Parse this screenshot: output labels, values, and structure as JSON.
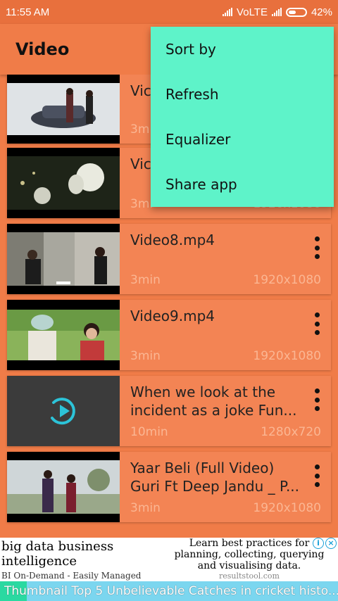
{
  "status_bar": {
    "time": "11:55 AM",
    "network": "VoLTE",
    "battery": "42%",
    "icons": [
      "signal-icon",
      "signal-icon",
      "battery-icon"
    ]
  },
  "app_bar": {
    "title": "Video"
  },
  "videos": [
    {
      "title": "Vic",
      "duration": "3m",
      "resolution": "",
      "thumb": "car-scene"
    },
    {
      "title": "Vic",
      "duration": "3mi",
      "resolution": "1920x1080",
      "thumb": "lanterns"
    },
    {
      "title": "Video8.mp4",
      "duration": "3min",
      "resolution": "1920x1080",
      "thumb": "couple-street"
    },
    {
      "title": "Video9.mp4",
      "duration": "3min",
      "resolution": "1920x1080",
      "thumb": "couple-field"
    },
    {
      "title": "When we look at the incident as a joke Fun...",
      "duration": "10min",
      "resolution": "1280x720",
      "thumb": "play-placeholder"
    },
    {
      "title": "Yaar Beli (Full Video) Guri Ft Deep Jandu _ P...",
      "duration": "3min",
      "resolution": "1920x1080",
      "thumb": "park-couple"
    }
  ],
  "overflow_menu": {
    "items": [
      "Sort by",
      "Refresh",
      "Equalizer",
      "Share app"
    ]
  },
  "ad_banner": {
    "left_heading": "big data business intelligence",
    "left_sub": "BI On-Demand - Easily Managed",
    "right_text": "Learn best practices for planning, collecting, querying and visualising data.",
    "right_url": "resultstool.com",
    "adchoice_icons": [
      "info-icon",
      "close-icon"
    ]
  },
  "ticker": {
    "text": "Thumbnail Top 5 Unbelievable Catches in cricket histo..."
  },
  "colors": {
    "primary": "#f07c48",
    "card": "#f38454",
    "menu": "#5ef3c9",
    "meta_text": "#fbb693"
  }
}
